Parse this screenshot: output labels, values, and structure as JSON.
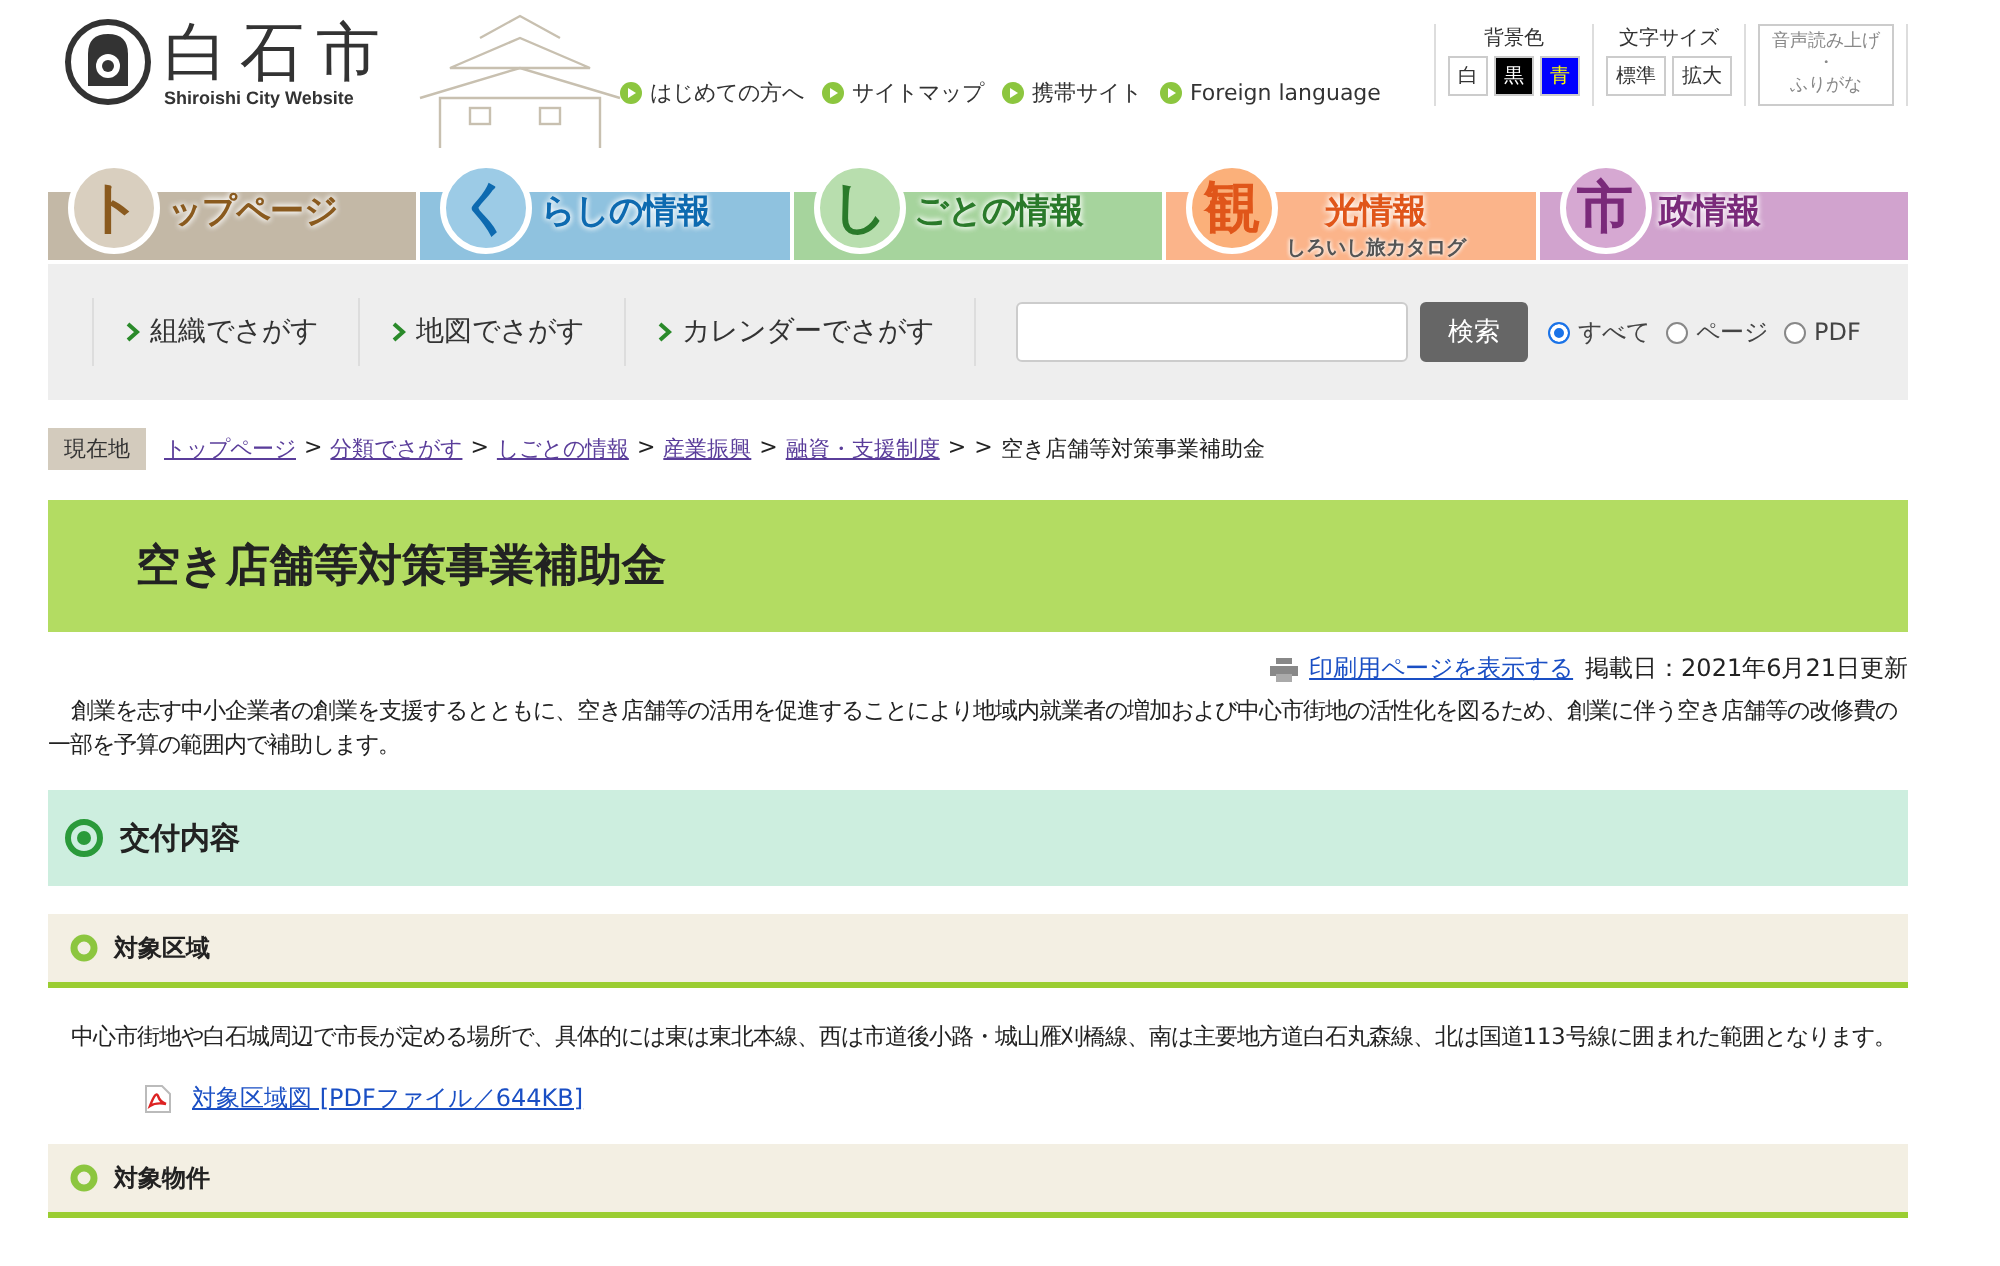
{
  "header": {
    "logo_title": "白石市",
    "logo_subtitle": "Shiroishi City Website",
    "links": [
      "はじめての方へ",
      "サイトマップ",
      "携帯サイト",
      "Foreign language"
    ],
    "bg_color": {
      "label": "背景色",
      "options": [
        {
          "label": "白",
          "color": "#ffffff"
        },
        {
          "label": "黒",
          "color": "#000000"
        },
        {
          "label": "青",
          "color": "#0000ff"
        }
      ]
    },
    "font_size": {
      "label": "文字サイズ",
      "options": [
        "標準",
        "拡大"
      ]
    },
    "reader": {
      "line1": "音声読み上げ",
      "dot": "・",
      "line2": "ふりがな"
    }
  },
  "nav_tabs": [
    {
      "char": "ト",
      "text": "ップページ",
      "color": "#c3b8a6"
    },
    {
      "char": "く",
      "text": "らしの情報",
      "color": "#8fc2df"
    },
    {
      "char": "し",
      "text": "ごとの情報",
      "color": "#a6d49d"
    },
    {
      "char": "観",
      "text": "光情報",
      "subtext": "しろいし旅カタログ",
      "color": "#fbb48a"
    },
    {
      "char": "市",
      "text": "政情報",
      "color": "#d1a3ce"
    }
  ],
  "search_bar": {
    "links": [
      "組織でさがす",
      "地図でさがす",
      "カレンダーでさがす"
    ],
    "button": "検索",
    "scopes": [
      {
        "label": "すべて",
        "selected": true
      },
      {
        "label": "ページ",
        "selected": false
      },
      {
        "label": "PDF",
        "selected": false
      }
    ]
  },
  "breadcrumb": {
    "label": "現在地",
    "separator": ">",
    "links": [
      "トップページ",
      "分類でさがす",
      "しごとの情報",
      "産業振興",
      "融資・支援制度"
    ],
    "current": "空き店舗等対策事業補助金"
  },
  "page_title": "空き店舗等対策事業補助金",
  "print_link": "印刷用ページを表示する",
  "updated": "掲載日：2021年6月21日更新",
  "intro": "創業を志す中小企業者の創業を支援するとともに、空き店舗等の活用を促進することにより地域内就業者の増加および中心市街地の活性化を図るため、創業に伴う空き店舗等の改修費の一部を予算の範囲内で補助します。",
  "sections": [
    {
      "kind": "h2",
      "title": "交付内容"
    },
    {
      "kind": "h3",
      "title": "対象区域"
    },
    {
      "kind": "text",
      "text": "中心市街地や白石城周辺で市長が定める場所で、具体的には東は東北本線、西は市道後小路・城山雁刈橋線、南は主要地方道白石丸森線、北は国道113号線に囲まれた範囲となります。"
    },
    {
      "kind": "pdf",
      "text": "対象区域図 [PDFファイル／644KB]"
    },
    {
      "kind": "h3",
      "title": "対象物件"
    }
  ]
}
